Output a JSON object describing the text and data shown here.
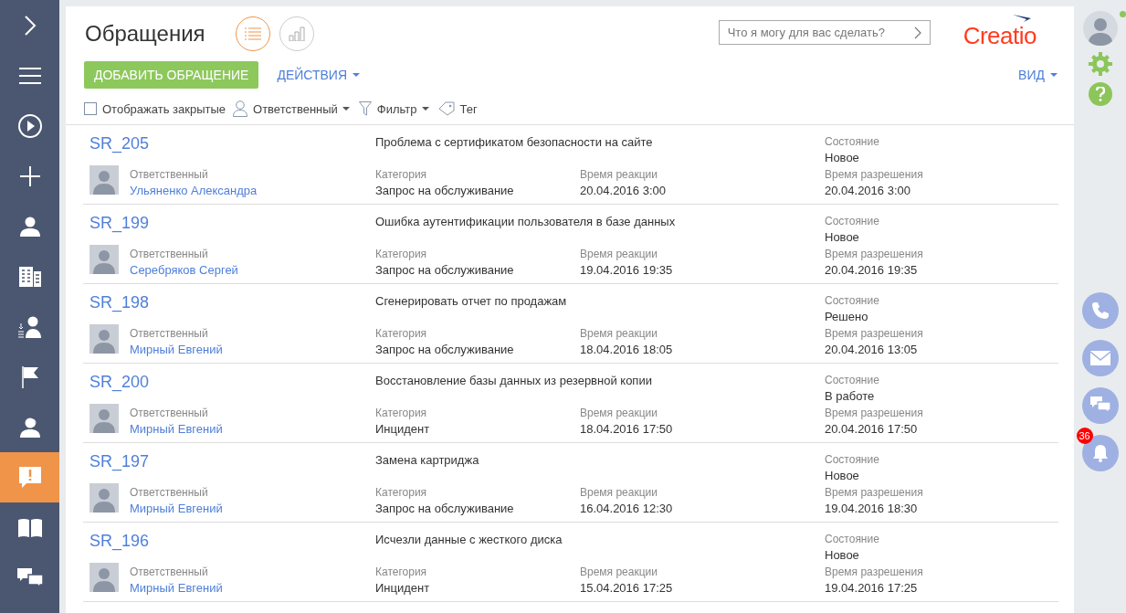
{
  "sidebar": {
    "items": [
      {
        "kind": "expand",
        "selected": false
      },
      {
        "kind": "menu",
        "selected": false
      },
      {
        "kind": "play",
        "selected": false
      },
      {
        "kind": "plus",
        "selected": false
      },
      {
        "kind": "person",
        "selected": false
      },
      {
        "kind": "building",
        "selected": false
      },
      {
        "kind": "lead",
        "selected": false
      },
      {
        "kind": "flag",
        "selected": false
      },
      {
        "kind": "agent",
        "selected": false
      },
      {
        "kind": "case",
        "selected": true
      },
      {
        "kind": "book",
        "selected": false
      },
      {
        "kind": "chat",
        "selected": false
      }
    ]
  },
  "header": {
    "title": "Обращения",
    "views": [
      {
        "kind": "list",
        "selected": true
      },
      {
        "kind": "chart",
        "selected": false
      }
    ],
    "search": {
      "placeholder": "Что я могу для вас сделать?"
    },
    "logo": "Creatio"
  },
  "toolbar": {
    "add_button": "ДОБАВИТЬ ОБРАЩЕНИЕ",
    "actions": "ДЕЙСТВИЯ",
    "view": "ВИД"
  },
  "filters": {
    "show_closed": {
      "label": "Отображать закрытые",
      "checked": false
    },
    "owner": "Ответственный",
    "filter": "Фильтр",
    "tag": "Тег"
  },
  "rows": [
    {
      "code": "SR_205",
      "subject": "Проблема с сертификатом безопасности на сайте",
      "owner_label": "Ответственный",
      "owner": "Ульяненко Александра",
      "category_label": "Категория",
      "category": "Запрос на обслуживание",
      "reaction_label": "Время реакции",
      "reaction": "20.04.2016 3:00",
      "state_label": "Состояние",
      "state": "Новое",
      "resolution_label": "Время разрешения",
      "resolution": "20.04.2016 3:00"
    },
    {
      "code": "SR_199",
      "subject": "Ошибка аутентификации пользователя в базе данных",
      "owner_label": "Ответственный",
      "owner": "Серебряков Сергей",
      "category_label": "Категория",
      "category": "Запрос на обслуживание",
      "reaction_label": "Время реакции",
      "reaction": "19.04.2016 19:35",
      "state_label": "Состояние",
      "state": "Новое",
      "resolution_label": "Время разрешения",
      "resolution": "20.04.2016 19:35"
    },
    {
      "code": "SR_198",
      "subject": "Сгенерировать отчет по продажам",
      "owner_label": "Ответственный",
      "owner": "Мирный Евгений",
      "category_label": "Категория",
      "category": "Запрос на обслуживание",
      "reaction_label": "Время реакции",
      "reaction": "18.04.2016 18:05",
      "state_label": "Состояние",
      "state": "Решено",
      "resolution_label": "Время разрешения",
      "resolution": "20.04.2016 13:05"
    },
    {
      "code": "SR_200",
      "subject": "Восстановление базы данных из резервной копии",
      "owner_label": "Ответственный",
      "owner": "Мирный Евгений",
      "category_label": "Категория",
      "category": "Инцидент",
      "reaction_label": "Время реакции",
      "reaction": "18.04.2016 17:50",
      "state_label": "Состояние",
      "state": "В работе",
      "resolution_label": "Время разрешения",
      "resolution": "20.04.2016 17:50"
    },
    {
      "code": "SR_197",
      "subject": "Замена картриджа",
      "owner_label": "Ответственный",
      "owner": "Мирный Евгений",
      "category_label": "Категория",
      "category": "Запрос на обслуживание",
      "reaction_label": "Время реакции",
      "reaction": "16.04.2016 12:30",
      "state_label": "Состояние",
      "state": "Новое",
      "resolution_label": "Время разрешения",
      "resolution": "19.04.2016 18:30"
    },
    {
      "code": "SR_196",
      "subject": "Исчезли данные с жесткого диска",
      "owner_label": "Ответственный",
      "owner": "Мирный Евгений",
      "category_label": "Категория",
      "category": "Инцидент",
      "reaction_label": "Время реакции",
      "reaction": "15.04.2016 17:25",
      "state_label": "Состояние",
      "state": "Новое",
      "resolution_label": "Время разрешения",
      "resolution": "19.04.2016 17:25"
    }
  ],
  "right_panel": {
    "online": true,
    "notifications": "36"
  }
}
